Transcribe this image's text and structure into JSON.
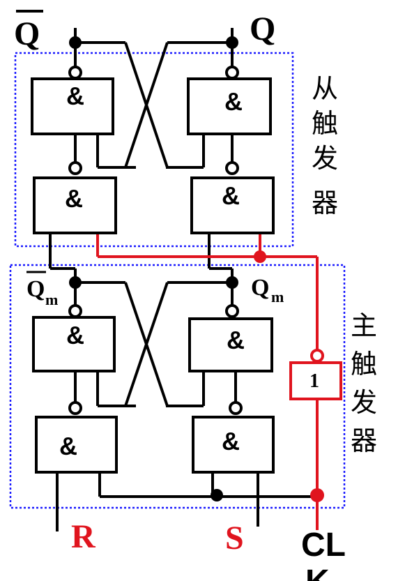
{
  "outputs": {
    "q_bar": "Q",
    "q": "Q"
  },
  "master_outputs": {
    "qm_bar_main": "Q",
    "qm_bar_sub": "m",
    "qm_main": "Q",
    "qm_sub": "m"
  },
  "gate_symbol": "&",
  "inverter_symbol": "1",
  "inputs": {
    "r": "R",
    "s": "S",
    "clk_line1": "CL",
    "clk_line2": "K"
  },
  "section_labels": {
    "slave": [
      "从",
      "触",
      "发",
      "器"
    ],
    "master": [
      "主",
      "触",
      "发",
      "器"
    ]
  },
  "colors": {
    "wire": "#000000",
    "clock": "#e0141e",
    "frame": "#1a1aff"
  }
}
